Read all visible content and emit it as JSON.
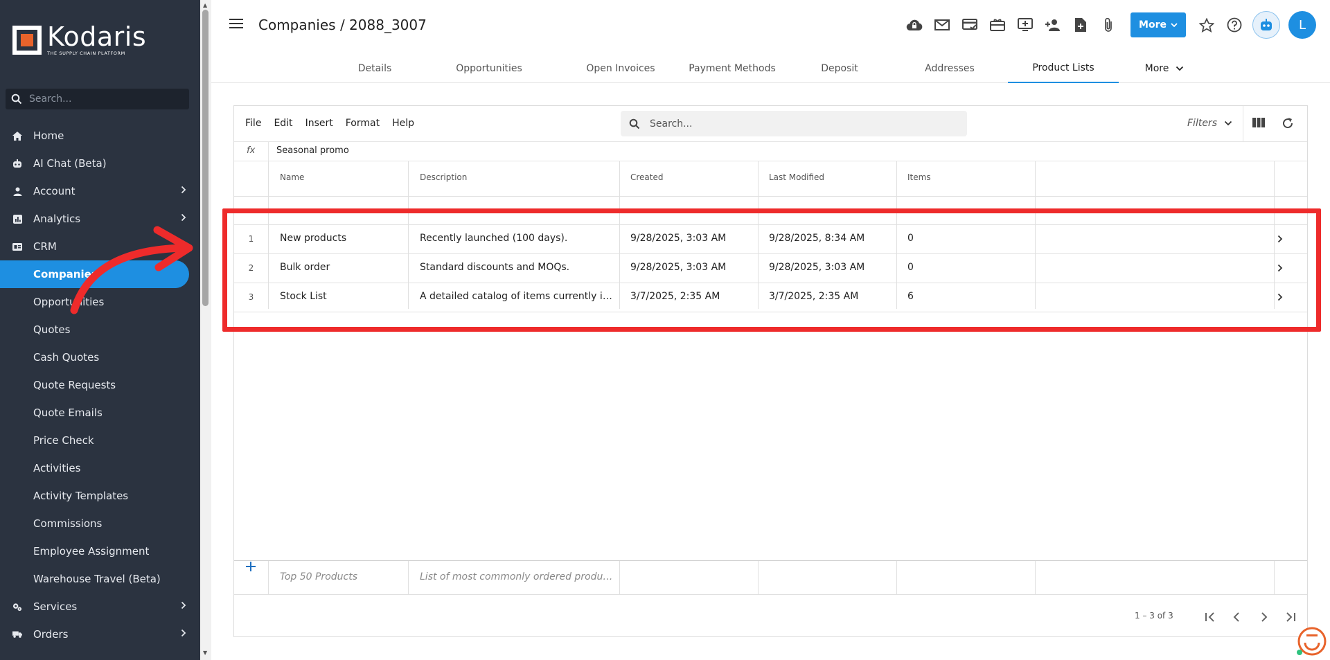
{
  "brand": {
    "name": "Kodaris",
    "tagline": "THE SUPPLY CHAIN PLATFORM"
  },
  "sidebar": {
    "search_placeholder": "Search...",
    "items": [
      {
        "label": "Home",
        "icon": "home-icon"
      },
      {
        "label": "AI Chat (Beta)",
        "icon": "robot-icon"
      },
      {
        "label": "Account",
        "icon": "person-icon"
      },
      {
        "label": "Analytics",
        "icon": "chart-icon"
      },
      {
        "label": "CRM",
        "icon": "crm-icon"
      }
    ],
    "crm_sub": [
      "Companies",
      "Opportunities",
      "Quotes",
      "Cash Quotes",
      "Quote Requests",
      "Quote Emails",
      "Price Check",
      "Activities",
      "Activity Templates",
      "Commissions",
      "Employee Assignment",
      "Warehouse Travel (Beta)"
    ],
    "bottom_items": [
      {
        "label": "Services",
        "icon": "services-icon"
      },
      {
        "label": "Orders",
        "icon": "truck-icon"
      }
    ]
  },
  "header": {
    "title": "Companies / 2088_3007",
    "more_label": "More",
    "avatar_initial": "L"
  },
  "tabs": [
    "Details",
    "Opportunities",
    "Open Invoices",
    "Payment Methods",
    "Deposit",
    "Addresses",
    "Product Lists",
    "More"
  ],
  "active_tab": "Product Lists",
  "grid": {
    "menu": [
      "File",
      "Edit",
      "Insert",
      "Format",
      "Help"
    ],
    "search_placeholder": "Search...",
    "filters_label": "Filters",
    "fx_label": "fx",
    "fx_value": "Seasonal promo",
    "columns": [
      "Name",
      "Description",
      "Created",
      "Last Modified",
      "Items"
    ],
    "rows": [
      {
        "num": "1",
        "name": "New products",
        "description": "Recently launched (100 days).",
        "created": "9/28/2025, 3:03 AM",
        "modified": "9/28/2025, 8:34 AM",
        "items": "0"
      },
      {
        "num": "2",
        "name": "Bulk order",
        "description": "Standard discounts and MOQs.",
        "created": "9/28/2025, 3:03 AM",
        "modified": "9/28/2025, 3:03 AM",
        "items": "0"
      },
      {
        "num": "3",
        "name": "Stock List",
        "description": "A detailed catalog of items currently in st...",
        "created": "3/7/2025, 2:35 AM",
        "modified": "3/7/2025, 2:35 AM",
        "items": "6"
      }
    ],
    "new_row": {
      "name_placeholder": "Top 50 Products",
      "description_placeholder": "List of most commonly ordered products"
    },
    "pager": "1 – 3 of 3"
  },
  "colors": {
    "accent": "#1e8fe1",
    "sidebar_bg": "#2b3340",
    "annotation": "#ee2b2b"
  }
}
